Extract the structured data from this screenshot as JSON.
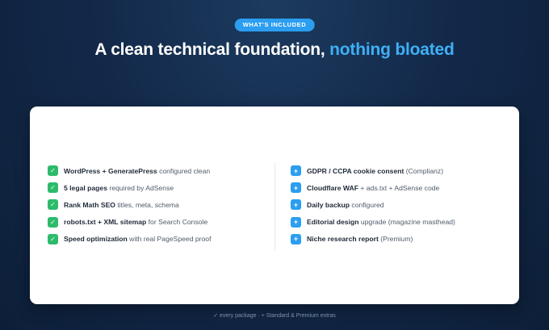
{
  "badge": "WHAT'S INCLUDED",
  "headline": {
    "main": "A clean technical foundation,",
    "accent": "nothing bloated"
  },
  "included": [
    {
      "bold": "WordPress + GeneratePress",
      "rest": " configured clean"
    },
    {
      "bold": "5 legal pages",
      "rest": " required by AdSense"
    },
    {
      "bold": "Rank Math SEO",
      "rest": " titles, meta, schema"
    },
    {
      "bold": "robots.txt + XML sitemap",
      "rest": " for Search Console"
    },
    {
      "bold": "Speed optimization",
      "rest": " with real PageSpeed proof"
    }
  ],
  "extras": [
    {
      "bold": "GDPR / CCPA cookie consent",
      "rest": " (Complianz)"
    },
    {
      "bold": "Cloudflare WAF",
      "rest": " + ads.txt + AdSense code"
    },
    {
      "bold": "Daily backup",
      "rest": " configured"
    },
    {
      "bold": "Editorial design",
      "rest": " upgrade (magazine masthead)"
    },
    {
      "bold": "Niche research report",
      "rest": " (Premium)"
    }
  ],
  "icons": {
    "included": "check-icon",
    "extras": "plus-icon"
  },
  "colors": {
    "accent": "#2b9ef0",
    "check": "#2dbb6b",
    "background": "#13294a"
  },
  "footer": "✓ every package · + Standard & Premium extras"
}
